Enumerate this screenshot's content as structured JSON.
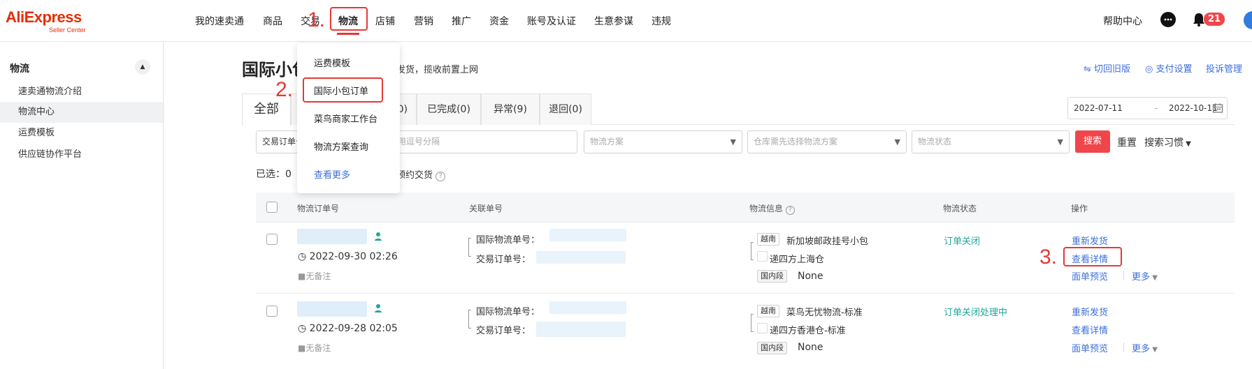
{
  "app": {
    "logo": "AliExpress",
    "logo_sub": "Seller Center"
  },
  "topnav": {
    "items": [
      "我的速卖通",
      "商品",
      "交易",
      "物流",
      "店铺",
      "营销",
      "推广",
      "资金",
      "账号及认证",
      "生意参谋",
      "违规"
    ],
    "active": "物流",
    "help": "帮助中心",
    "notification_count": "21"
  },
  "annotations": {
    "step1": "1.",
    "step2": "2.",
    "step3": "3."
  },
  "dropdown": {
    "items": [
      "运费模板",
      "国际小包订单",
      "菜鸟商家工作台",
      "物流方案查询",
      "查看更多"
    ],
    "highlighted": "国际小包订单"
  },
  "sidebar": {
    "title": "物流",
    "items": [
      "速卖通物流介绍",
      "物流中心",
      "运费模板",
      "供应链协作平台"
    ],
    "active": "物流中心"
  },
  "page": {
    "title": "国际小包",
    "description": "包发货，揽收前置上网",
    "links": [
      "切回旧版",
      "支付设置",
      "投诉管理"
    ]
  },
  "tabs": [
    {
      "label": "全部",
      "active": true
    },
    {
      "label": "0)"
    },
    {
      "label": "已完成(0)"
    },
    {
      "label": "异常(9)"
    },
    {
      "label": "退回(0)"
    }
  ],
  "date_range": {
    "start": "2022-07-11",
    "separator": "-",
    "end": "2022-10-11"
  },
  "filters": {
    "order_type_label": "交易订单号",
    "order_input_placeholder": "用逗号分隔",
    "logistics_plan_placeholder": "物流方案",
    "warehouse_placeholder": "仓库需先选择物流方案",
    "status_placeholder": "物流状态",
    "search_label": "搜索",
    "reset_label": "重置",
    "habit_label": "搜索习惯"
  },
  "selection": {
    "selected_label": "已选：0",
    "booking_link": "预约交货"
  },
  "table": {
    "columns": [
      "物流订单号",
      "关联单号",
      "物流信息",
      "物流状态",
      "操作"
    ],
    "intl_label": "国际物流单号：",
    "trade_label": "交易订单号：",
    "domestic_tag": "国内段",
    "no_note": "无备注",
    "rows": [
      {
        "time": "2022-09-30 02:26",
        "country": "越南",
        "service": "新加坡邮政挂号小包",
        "warehouse": "递四方上海仓",
        "domestic": "None",
        "status": "订单关闭",
        "actions": [
          "重新发货",
          "查看详情",
          "面单预览",
          "更多"
        ]
      },
      {
        "time": "2022-09-28 02:05",
        "country": "越南",
        "service": "菜鸟无忧物流-标准",
        "warehouse": "递四方香港仓-标准",
        "domestic": "None",
        "status": "订单关闭处理中",
        "actions": [
          "重新发货",
          "查看详情",
          "面单预览",
          "更多"
        ]
      }
    ]
  }
}
